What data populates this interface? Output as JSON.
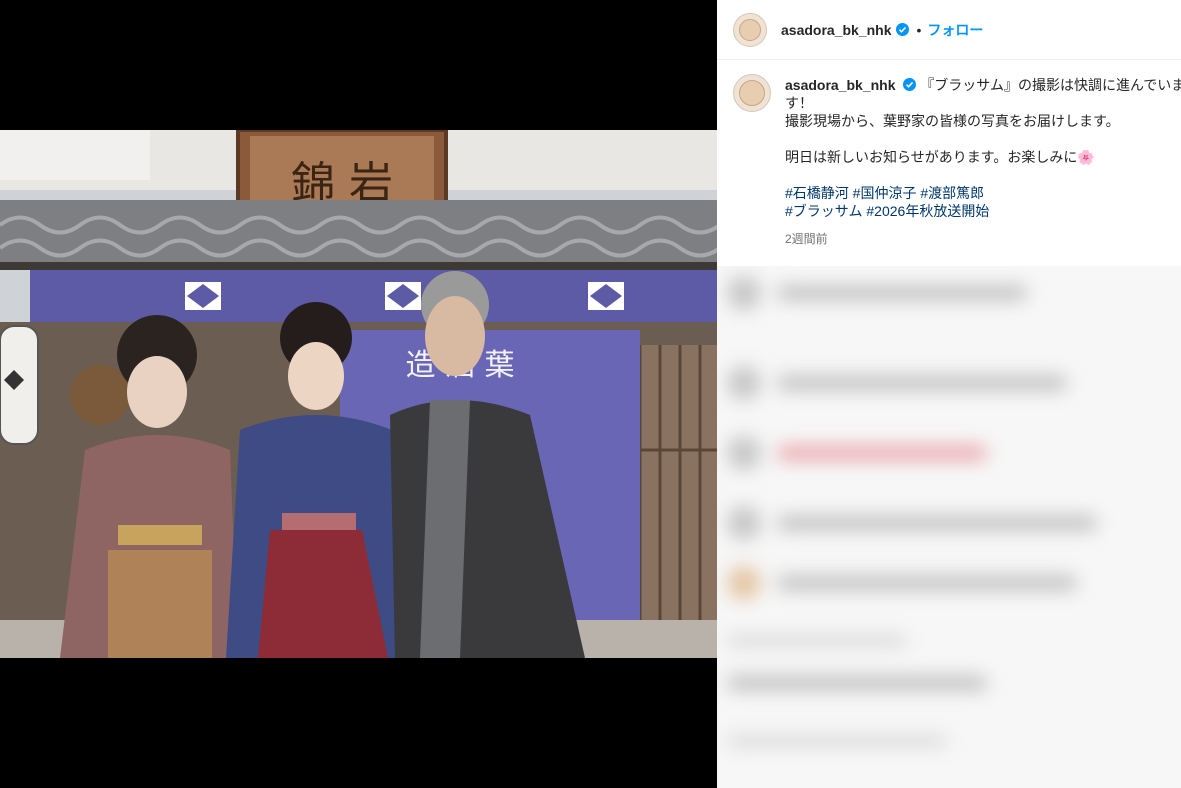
{
  "post": {
    "username": "asadora_bk_nhk",
    "follow_label": "フォロー",
    "separator": "•",
    "caption_lines": [
      "『ブラッサム』の撮影は快調に進んでいま",
      "す！",
      "撮影現場から、葉野家の皆様の写真をお届けします。"
    ],
    "caption_line2": "明日は新しいお知らせがあります。お楽しみに🌸",
    "hashtags_line1": "#石橋静河 #国仲涼子 #渡部篤郎",
    "hashtags_line2": "#ブラッサム #2026年秋放送開始",
    "time": "2週間前"
  },
  "photo": {
    "sign_text": "錦 岩",
    "noren_text": "造 酒 葉",
    "alt": "photo"
  },
  "colors": {
    "link": "#0095f6",
    "hashtag": "#00376b",
    "verified": "#0095f6"
  }
}
